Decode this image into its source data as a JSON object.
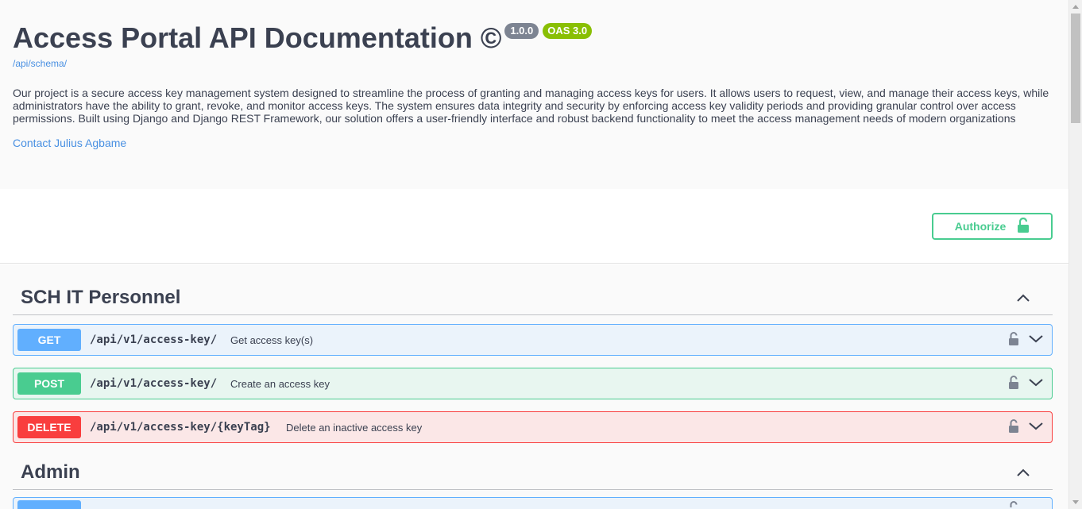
{
  "info": {
    "title": "Access Portal API Documentation ©",
    "version_badge": "1.0.0",
    "oas_badge": "OAS 3.0",
    "schema_link": "/api/schema/",
    "description": "Our project is a secure access key management system designed to streamline the process of granting and managing access keys for users. It allows users to request, view, and manage their access keys, while administrators have the ability to grant, revoke, and monitor access keys. The system ensures data integrity and security by enforcing access key validity periods and providing granular control over access permissions. Built using Django and Django REST Framework, our solution offers a user-friendly interface and robust backend functionality to meet the access management needs of modern organizations",
    "contact_link": "Contact Julius Agbame"
  },
  "auth": {
    "authorize_label": "Authorize",
    "icon": "unlocked-padlock-icon"
  },
  "colors": {
    "get": "#61affe",
    "post": "#49cc90",
    "delete": "#f93e3e",
    "link": "#4990e2",
    "version_badge": "#7d8492",
    "oas_badge": "#89bf04"
  },
  "tags": [
    {
      "name": "SCH IT Personnel",
      "operations": [
        {
          "method": "GET",
          "path": "/api/v1/access-key/",
          "summary": "Get access key(s)"
        },
        {
          "method": "POST",
          "path": "/api/v1/access-key/",
          "summary": "Create an access key"
        },
        {
          "method": "DELETE",
          "path": "/api/v1/access-key/{keyTag}",
          "summary": "Delete an inactive access key"
        }
      ]
    },
    {
      "name": "Admin",
      "operations": []
    }
  ]
}
